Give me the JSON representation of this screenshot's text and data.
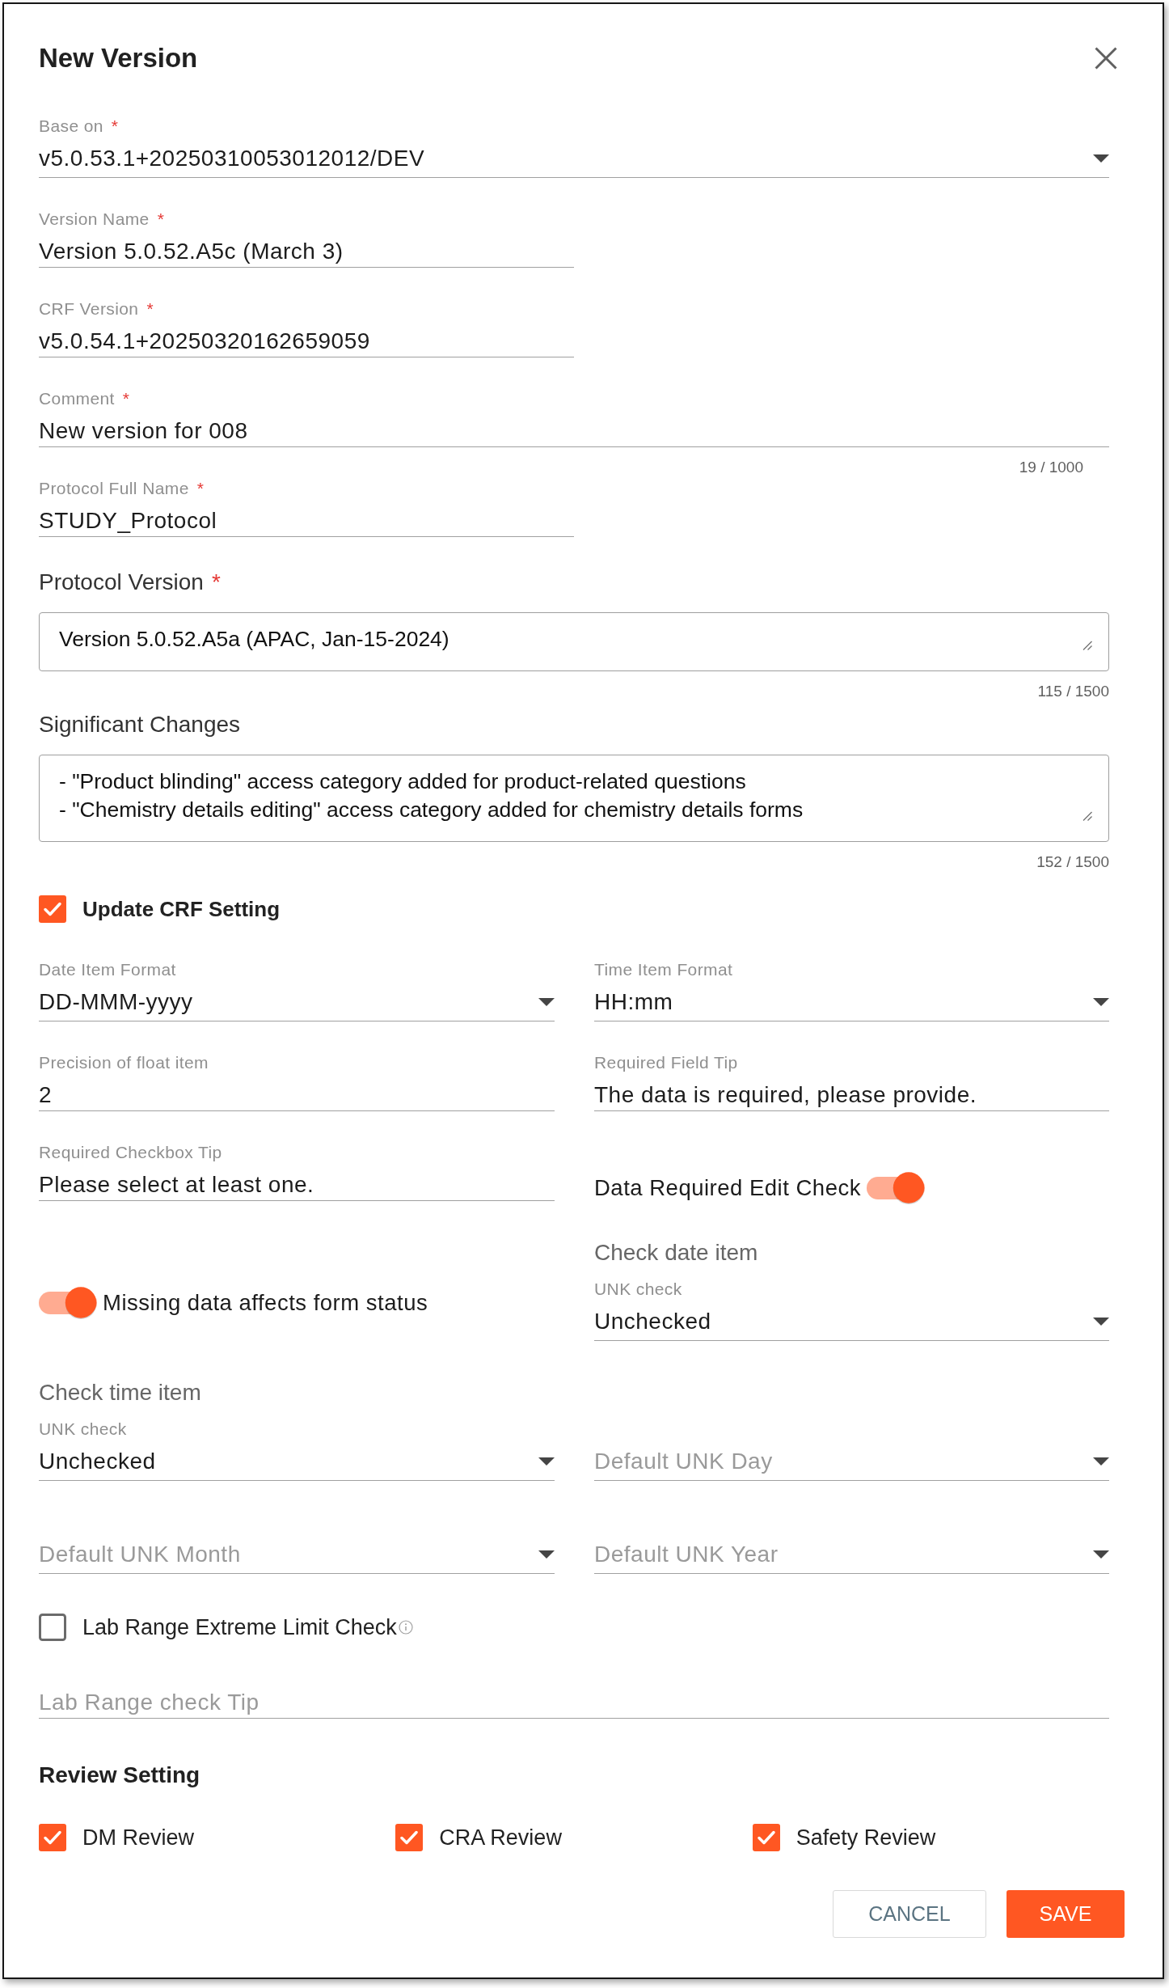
{
  "dialog": {
    "title": "New Version"
  },
  "fields": [
    {
      "kind": "select",
      "label": "Base on",
      "required_mark": "*",
      "value": "v5.0.53.1+20250310053012012/DEV"
    },
    {
      "kind": "input",
      "label": "Version Name",
      "required_mark": "*",
      "value": "Version 5.0.52.A5c (March 3)"
    },
    {
      "kind": "input",
      "label": "CRF Version",
      "required_mark": "*",
      "value": "v5.0.54.1+20250320162659059"
    },
    {
      "kind": "input",
      "label": "Comment",
      "required_mark": "*",
      "value": "New version for 008",
      "counter": "19 / 1000"
    },
    {
      "kind": "input",
      "label": "Protocol Full Name",
      "required_mark": "*",
      "value": "STUDY_Protocol"
    },
    {
      "kind": "textarea",
      "label": "Protocol Version",
      "required_mark": "*",
      "value": "Version 5.0.52.A5a (APAC, Jan-15-2024)",
      "counter": "115 / 1500"
    },
    {
      "kind": "textarea",
      "label": "Significant Changes",
      "value": "- \"Product blinding\" access category added for product-related questions\n- \"Chemistry details editing\" access category added for chemistry details forms",
      "counter": "152 / 1500"
    }
  ],
  "crf_settings": {
    "update_checkbox": {
      "label": "Update CRF Setting",
      "checked": true
    },
    "rows": [
      [
        {
          "kind": "select",
          "label": "Date Item Format",
          "value": "DD-MMM-yyyy"
        },
        {
          "kind": "select",
          "label": "Time Item Format",
          "value": "HH:mm"
        }
      ],
      [
        {
          "kind": "input",
          "label": "Precision of float item",
          "value": "2"
        },
        {
          "kind": "input",
          "label": "Required Field Tip",
          "value": "The data is required, please provide."
        }
      ],
      [
        {
          "kind": "input",
          "label": "Required Checkbox Tip",
          "value": "Please select at least one."
        },
        {
          "kind": "switch",
          "label": "Data Required Edit Check",
          "on": true
        }
      ],
      [
        {
          "kind": "toggle",
          "label": "Missing data affects form status",
          "on": true
        },
        {
          "kind": "group",
          "heading": "Check date item",
          "field": {
            "kind": "select",
            "label": "UNK check",
            "value": "Unchecked"
          }
        }
      ],
      [
        {
          "kind": "group",
          "heading": "Check time item",
          "field": {
            "kind": "select",
            "label": "UNK check",
            "value": "Unchecked"
          }
        },
        {
          "kind": "select",
          "placeholder": "Default UNK Day"
        }
      ],
      [
        {
          "kind": "select",
          "placeholder": "Default UNK Month"
        },
        {
          "kind": "select",
          "placeholder": "Default UNK Year"
        }
      ]
    ],
    "lab_range_check": {
      "label": "Lab Range Extreme Limit Check",
      "checked": false
    },
    "lab_range_tip": {
      "kind": "input",
      "placeholder": "Lab Range check Tip"
    }
  },
  "review": {
    "heading": "Review Setting",
    "options": [
      {
        "label": "DM Review",
        "checked": true
      },
      {
        "label": "CRA Review",
        "checked": true
      },
      {
        "label": "Safety Review",
        "checked": true
      }
    ]
  },
  "buttons": [
    {
      "kind": "secondary",
      "label": "CANCEL"
    },
    {
      "kind": "primary",
      "label": "SAVE"
    }
  ]
}
